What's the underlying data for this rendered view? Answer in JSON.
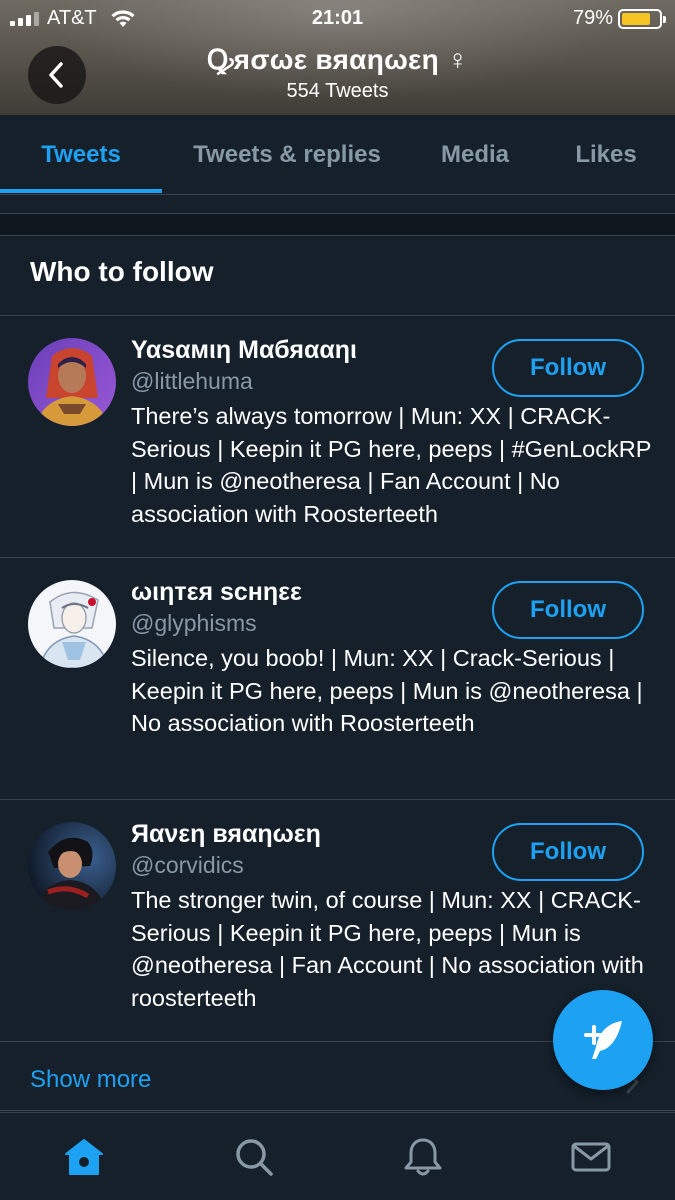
{
  "status_bar": {
    "carrier": "AT&T",
    "time": "21:01",
    "battery_percent": "79%",
    "battery_level": 0.79,
    "battery_color": "#f5c324"
  },
  "header": {
    "profile_name": "Ꝙяσωε вяαηωεη ♀",
    "tweet_count": "554 Tweets",
    "back_icon": "chevron-left-icon"
  },
  "tabs": [
    {
      "label": "Tweets",
      "active": true
    },
    {
      "label": "Tweets & replies",
      "active": false
    },
    {
      "label": "Media",
      "active": false
    },
    {
      "label": "Likes",
      "active": false
    }
  ],
  "who_to_follow": {
    "title": "Who to follow",
    "follow_label": "Follow",
    "users": [
      {
        "name": "Υαsαмιη Μαбяααηι",
        "handle": "@littlehuma",
        "bio": "There’s always tomorrow | Mun: XX | CRACK-Serious | Keepin it PG here, peeps | #GenLockRP | Mun is @neotheresa | Fan Account | No association with Roosterteeth"
      },
      {
        "name": "ωιηтεя ѕcнηεε",
        "handle": "@glyphisms",
        "bio": "Silence, you boob! | Mun: XX | Crack-Serious | Keepin it PG here, peeps | Mun is @neotheresa | No association with Roosterteeth"
      },
      {
        "name": "Яανεη вяαηωεη",
        "handle": "@corvidics",
        "bio": "The stronger twin, of course | Mun: XX | CRACK-Serious | Keepin it PG here, peeps | Mun is @neotheresa | Fan Account | No association with roosterteeth"
      }
    ],
    "show_more": "Show more"
  },
  "compose": {
    "icon": "compose-tweet-icon"
  },
  "bottom_nav": [
    {
      "icon": "home-icon",
      "active": true
    },
    {
      "icon": "search-icon",
      "active": false
    },
    {
      "icon": "bell-icon",
      "active": false
    },
    {
      "icon": "mail-icon",
      "active": false
    }
  ],
  "colors": {
    "background": "#15202b",
    "accent": "#1da1f2",
    "secondary_text": "#8899a6",
    "border": "#38444d"
  }
}
